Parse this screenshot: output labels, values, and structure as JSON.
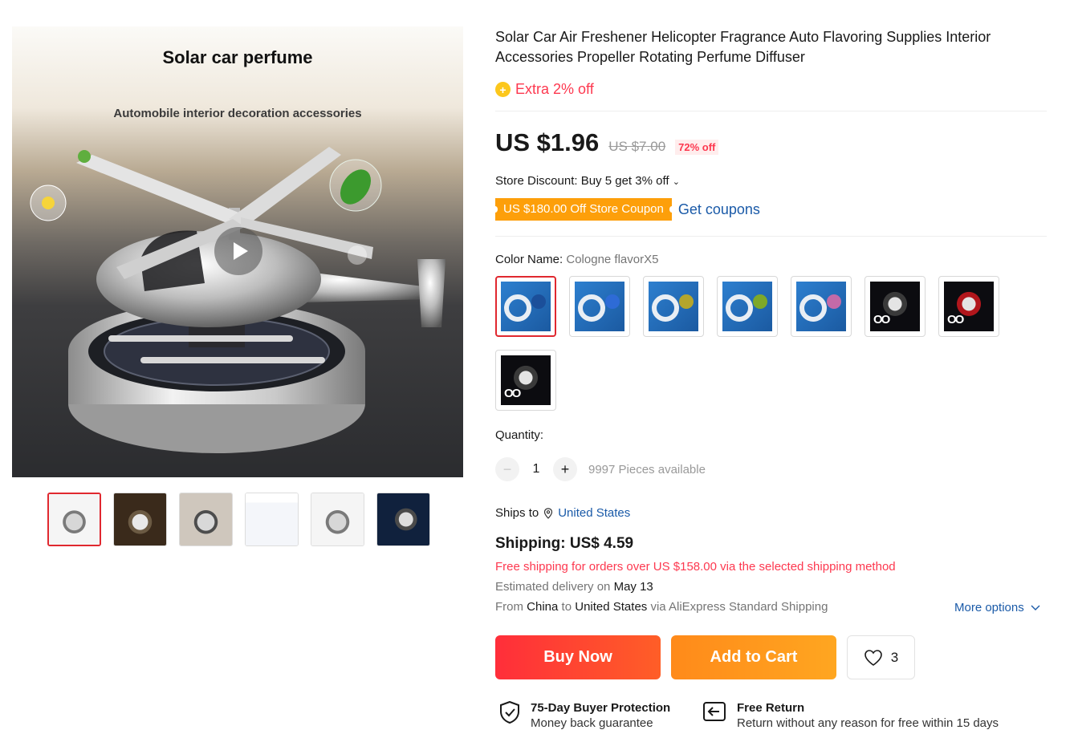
{
  "gallery": {
    "hero_title": "Solar car perfume",
    "hero_subtitle": "Automobile interior decoration accessories",
    "thumbnails": [
      "video",
      "warm",
      "bright",
      "doc",
      "light",
      "dark"
    ]
  },
  "product": {
    "title": "Solar Car Air Freshener Helicopter Fragrance Auto Flavoring Supplies Interior Accessories Propeller Rotating Perfume Diffuser",
    "extra_discount": "Extra 2% off",
    "extra_icon": "coin-plus-icon"
  },
  "price": {
    "current": "US $1.96",
    "original": "US $7.00",
    "discount": "72% off"
  },
  "store": {
    "discount_text": "Store Discount: Buy 5 get 3% off",
    "coupon_tag": "US $180.00 Off Store Coupon",
    "get_coupons": "Get coupons"
  },
  "color": {
    "label": "Color Name:",
    "selected": "Cologne flavorX5",
    "accent_dots": [
      "#1b4f9a",
      "#2e6bd6",
      "#b4a52c",
      "#7ea829",
      "#c36aa8"
    ]
  },
  "quantity": {
    "label": "Quantity:",
    "value": "1",
    "minus": "−",
    "plus": "+",
    "available": "9997 Pieces available"
  },
  "shipping": {
    "ships_to_label": "Ships to",
    "ships_to_country": "United States",
    "cost": "Shipping: US$ 4.59",
    "free_note": "Free shipping for orders over US $158.00 via the selected shipping method",
    "est_label": "Estimated delivery on",
    "est_date": "May 13",
    "from_label": "From",
    "from_country": "China",
    "to_label": "to",
    "to_country": "United States",
    "via_label": "via AliExpress Standard Shipping",
    "more_options": "More options"
  },
  "actions": {
    "buy_now": "Buy Now",
    "add_to_cart": "Add to Cart",
    "wishlist_count": "3"
  },
  "guarantees": {
    "protection_title": "75-Day Buyer Protection",
    "protection_desc": "Money back guarantee",
    "return_title": "Free Return",
    "return_desc": "Return without any reason for free within 15 days"
  },
  "colors": {
    "accent_red": "#fd384f",
    "link_blue": "#1a5aa8",
    "coupon_orange": "#fd9f0a"
  }
}
